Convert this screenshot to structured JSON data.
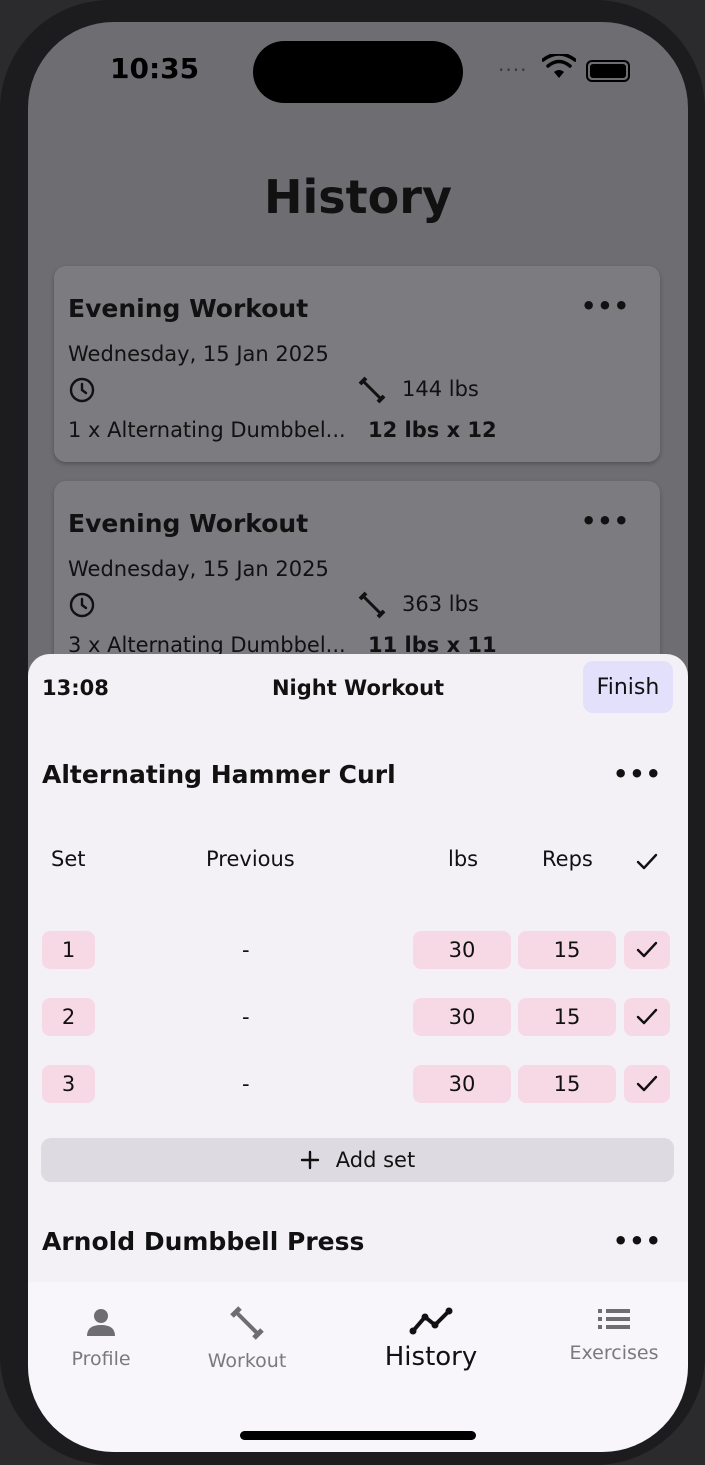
{
  "status": {
    "time": "10:35"
  },
  "page": {
    "title": "History"
  },
  "history_cards": [
    {
      "title": "Evening Workout",
      "date": "Wednesday, 15 Jan 2025",
      "weight": "144 lbs",
      "exercise": "1 x Alternating Dumbbel...",
      "best": "12 lbs x 12"
    },
    {
      "title": "Evening Workout",
      "date": "Wednesday, 15 Jan 2025",
      "weight": "363 lbs",
      "exercise": "3 x Alternating Dumbbel...",
      "best": "11 lbs x 11"
    }
  ],
  "active_workout": {
    "timer": "13:08",
    "title": "Night Workout",
    "finish_label": "Finish",
    "exercises": [
      {
        "name": "Alternating Hammer Curl",
        "columns": {
          "set": "Set",
          "previous": "Previous",
          "lbs": "lbs",
          "reps": "Reps"
        },
        "sets": [
          {
            "set": "1",
            "previous": "-",
            "lbs": "30",
            "reps": "15",
            "done": true
          },
          {
            "set": "2",
            "previous": "-",
            "lbs": "30",
            "reps": "15",
            "done": true
          },
          {
            "set": "3",
            "previous": "-",
            "lbs": "30",
            "reps": "15",
            "done": true
          }
        ],
        "add_set_label": "Add set"
      },
      {
        "name": "Arnold Dumbbell Press"
      }
    ]
  },
  "tabs": [
    {
      "label": "Profile",
      "icon": "person-icon",
      "active": false
    },
    {
      "label": "Workout",
      "icon": "dumbbell-icon",
      "active": false
    },
    {
      "label": "History",
      "icon": "chart-line-icon",
      "active": true
    },
    {
      "label": "Exercises",
      "icon": "list-icon",
      "active": false
    }
  ],
  "colors": {
    "set_cell": "#f7d9e6",
    "finish_button": "#e2e0fb",
    "sheet_background": "#f3f1f6",
    "dim_overlay": "#6e6d72"
  }
}
